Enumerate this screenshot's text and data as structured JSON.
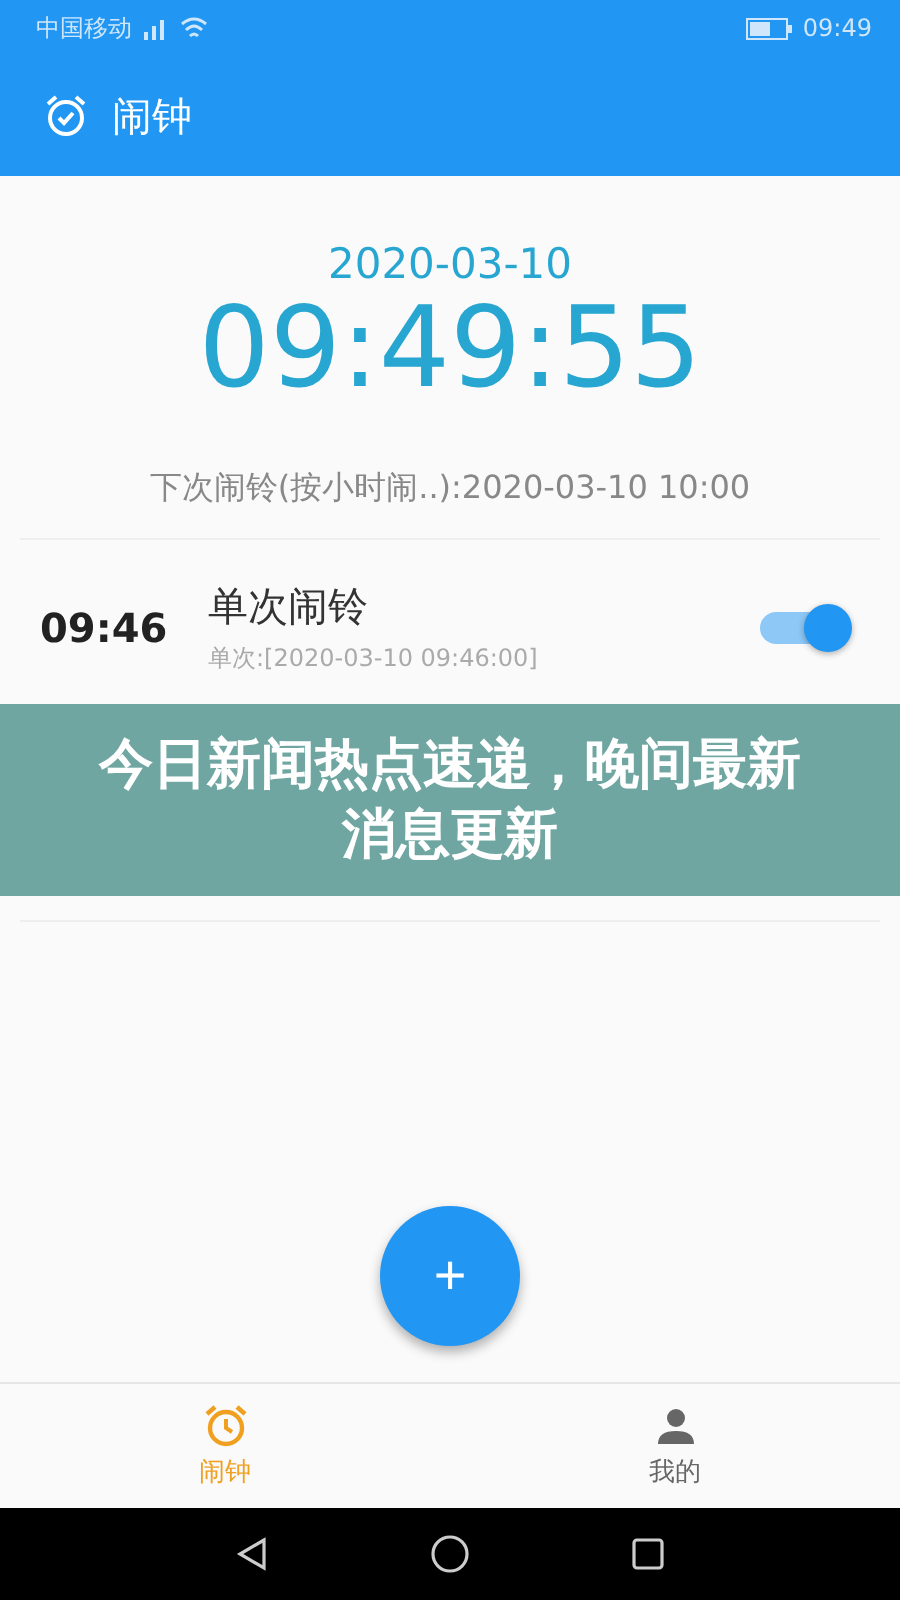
{
  "status_bar": {
    "carrier": "中国移动",
    "time": "09:49"
  },
  "app_bar": {
    "title": "闹钟"
  },
  "clock": {
    "date": "2020-03-10",
    "time": "09:49:55"
  },
  "next_alarm": "下次闹铃(按小时闹..):2020-03-10 10:00",
  "alarms": [
    {
      "time": "09:46",
      "title": "单次闹铃",
      "subtitle": "单次:[2020-03-10 09:46:00]",
      "on": true
    }
  ],
  "fab": {
    "label": "+"
  },
  "bottom_nav": [
    {
      "label": "闹钟",
      "kind": "alarm",
      "selected": true
    },
    {
      "label": "我的",
      "kind": "person",
      "selected": false
    }
  ],
  "banner": {
    "text": "今日新闻热点速递，晚间最新消息更新"
  }
}
